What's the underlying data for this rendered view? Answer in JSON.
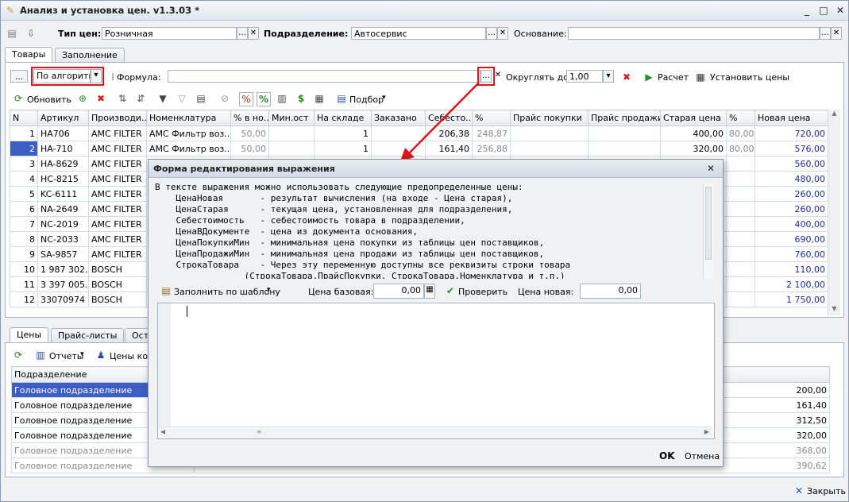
{
  "window": {
    "title": "Анализ и установка цен. v1.3.03 *"
  },
  "header": {
    "price_type_label": "Тип цен:",
    "price_type_value": "Розничная",
    "division_label": "Подразделение:",
    "division_value": "Автосервис",
    "basis_label": "Основание:",
    "basis_value": ""
  },
  "tabs_top": [
    "Товары",
    "Заполнение"
  ],
  "toolbar1": {
    "dots": "...",
    "algorithm_value": "По алгоритму",
    "formula_label": "Формула:",
    "formula_value": "",
    "round_label": "Округлять до:",
    "round_value": "1,00",
    "calc_label": "Расчет",
    "set_prices_label": "Установить цены"
  },
  "toolbar2": {
    "refresh_label": "Обновить",
    "selection_label": "Подбор"
  },
  "goods_table": {
    "columns": [
      "N",
      "Артикул",
      "Производи...",
      "Номенклатура",
      "% в но...",
      "Мин.ост",
      "На складе",
      "Заказано",
      "Себесто...",
      "%",
      "Прайс покупки",
      "Прайс продажи",
      "Старая цена",
      "%",
      "Новая цена"
    ],
    "rows": [
      [
        "1",
        "HA706",
        "AMC FILTER",
        "АМС Фильтр воз...",
        "50,00",
        "",
        "1",
        "",
        "206,38",
        "248,87",
        "",
        "",
        "400,00",
        "80,00",
        "720,00"
      ],
      [
        "2",
        "HA-710",
        "AMC FILTER",
        "АМС Фильтр воз...",
        "50,00",
        "",
        "1",
        "",
        "161,40",
        "256,88",
        "",
        "",
        "320,00",
        "80,00",
        "576,00"
      ],
      [
        "3",
        "HA-8629",
        "AMC FILTER",
        "",
        "",
        "",
        "",
        "",
        "",
        "",
        "",
        "",
        "",
        "",
        "560,00"
      ],
      [
        "4",
        "HC-8215",
        "AMC FILTER",
        "",
        "",
        "",
        "",
        "",
        "",
        "",
        "",
        "",
        "",
        "",
        "480,00"
      ],
      [
        "5",
        "KC-6111",
        "AMC FILTER",
        "",
        "",
        "",
        "",
        "",
        "",
        "",
        "",
        "",
        "",
        "",
        "260,00"
      ],
      [
        "6",
        "NA-2649",
        "AMC FILTER",
        "",
        "",
        "",
        "",
        "",
        "",
        "",
        "",
        "",
        "",
        "",
        "260,00"
      ],
      [
        "7",
        "NC-2019",
        "AMC FILTER",
        "",
        "",
        "",
        "",
        "",
        "",
        "",
        "",
        "",
        "",
        "",
        "400,00"
      ],
      [
        "8",
        "NC-2033",
        "AMC FILTER",
        "",
        "",
        "",
        "",
        "",
        "",
        "",
        "",
        "",
        "",
        "",
        "690,00"
      ],
      [
        "9",
        "SA-9857",
        "AMC FILTER",
        "",
        "",
        "",
        "",
        "",
        "",
        "",
        "",
        "",
        "",
        "",
        "760,00"
      ],
      [
        "10",
        "1 987 302...",
        "BOSCH",
        "",
        "",
        "",
        "",
        "",
        "",
        "",
        "",
        "",
        "",
        "",
        "110,00"
      ],
      [
        "11",
        "3 397 005...",
        "BOSCH",
        "",
        "",
        "",
        "",
        "",
        "",
        "",
        "",
        "",
        "",
        "",
        "2 100,00"
      ],
      [
        "12",
        "33070974",
        "BOSCH",
        "",
        "",
        "",
        "",
        "",
        "",
        "",
        "",
        "",
        "",
        "",
        "1 750,00"
      ]
    ]
  },
  "tabs_bottom": [
    "Цены",
    "Прайс-листы",
    "Ост"
  ],
  "bottom_toolbar": {
    "reports_label": "Отчеты",
    "competitors_label": "Цены кон"
  },
  "prices_table": {
    "column": "Подразделение",
    "rows": [
      {
        "division": "Головное подразделение",
        "value": "200,00"
      },
      {
        "division": "Головное подразделение",
        "value": "161,40"
      },
      {
        "division": "Головное подразделение",
        "value": "312,50"
      },
      {
        "division": "Головное подразделение",
        "value": "320,00"
      },
      {
        "division": "Головное подразделение",
        "value": "368,00"
      },
      {
        "division": "Головное подразделение",
        "value": "390,62"
      }
    ]
  },
  "footer": {
    "close_label": "Закрыть"
  },
  "dialog": {
    "title": "Форма редактирования выражения",
    "help_lines": [
      "В тексте выражения можно использовать следующие предопределенные цены:",
      "    ЦенаНовая       - результат вычисления (на входе - Цена старая),",
      "    ЦенаСтарая      - текущая цена, установленная для подразделения,",
      "    Себестоимость   - себестоимость товара в подразделении,",
      "    ЦенаВДокументе  - цена из документа основания,",
      "    ЦенаПокупкиМин  - минимальная цена покупки из таблицы цен поставщиков,",
      "    ЦенаПродажиМин  - минимальная цена продажи из таблицы цен поставщиков,",
      "    СтрокаТовара    - Через эту переменную доступны все реквизиты строки товара",
      "                 (СтрокаТовара.ПрайсПокупки, СтрокаТовара.Номенклатура и т.п.)"
    ],
    "fill_template_label": "Заполнить по шаблону",
    "base_price_label": "Цена базовая:",
    "base_price_value": "0,00",
    "check_label": "Проверить",
    "new_price_label": "Цена новая:",
    "new_price_value": "0,00",
    "expression_value": "",
    "ok_label": "OK",
    "cancel_label": "Отмена"
  },
  "colors": {
    "accent_red": "#e0141b",
    "selection": "#3d5fc5",
    "new_price": "#1a2aa8"
  }
}
